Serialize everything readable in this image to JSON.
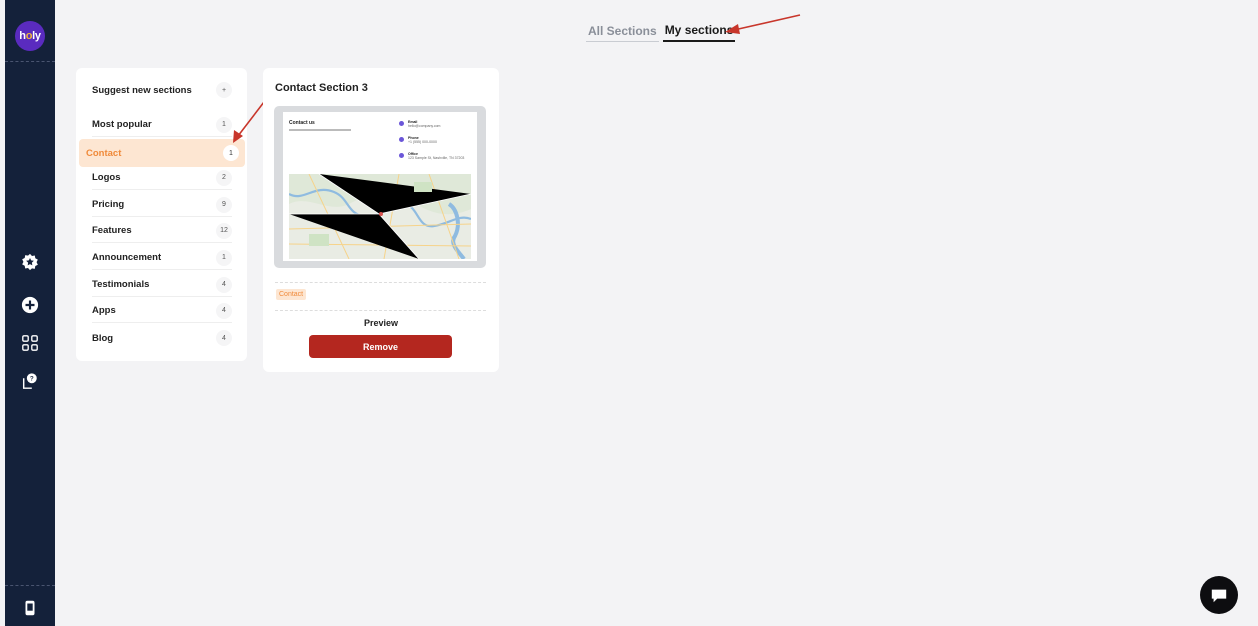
{
  "sidebar": {
    "logo_text_pre": "h",
    "logo_text_o": "o",
    "logo_text_post": "ly",
    "icons": [
      "star-badge-icon",
      "add-circle-icon",
      "grid-icon",
      "chat-help-icon",
      "device-icon"
    ]
  },
  "tabs": {
    "all_sections": "All Sections",
    "my_sections": "My sections",
    "active": "my_sections"
  },
  "categories": {
    "suggest": {
      "label": "Suggest new sections",
      "icon": "+"
    },
    "items": [
      {
        "label": "Most popular",
        "count": "1"
      },
      {
        "label": "Contact",
        "count": "1",
        "selected": true
      },
      {
        "label": "Logos",
        "count": "2"
      },
      {
        "label": "Pricing",
        "count": "9"
      },
      {
        "label": "Features",
        "count": "12"
      },
      {
        "label": "Announcement",
        "count": "1"
      },
      {
        "label": "Testimonials",
        "count": "4"
      },
      {
        "label": "Apps",
        "count": "4"
      },
      {
        "label": "Blog",
        "count": "4"
      }
    ]
  },
  "card": {
    "title": "Contact Section 3",
    "thumbnail": {
      "heading": "Contact us",
      "contacts": [
        {
          "label": "Email",
          "value": "hello@company.com"
        },
        {
          "label": "Phone",
          "value": "+1 (555) 000-0000"
        },
        {
          "label": "Office",
          "value": "123 Sample St, Nashville, TN 37203"
        }
      ]
    },
    "tag": "Contact",
    "preview_label": "Preview",
    "remove_label": "Remove"
  },
  "colors": {
    "sidebar_bg": "#14213a",
    "accent_orange": "#f08a3a",
    "selected_bg": "#fde6d2",
    "remove_btn": "#b4271f",
    "annotation_arrow": "#c8362b"
  }
}
